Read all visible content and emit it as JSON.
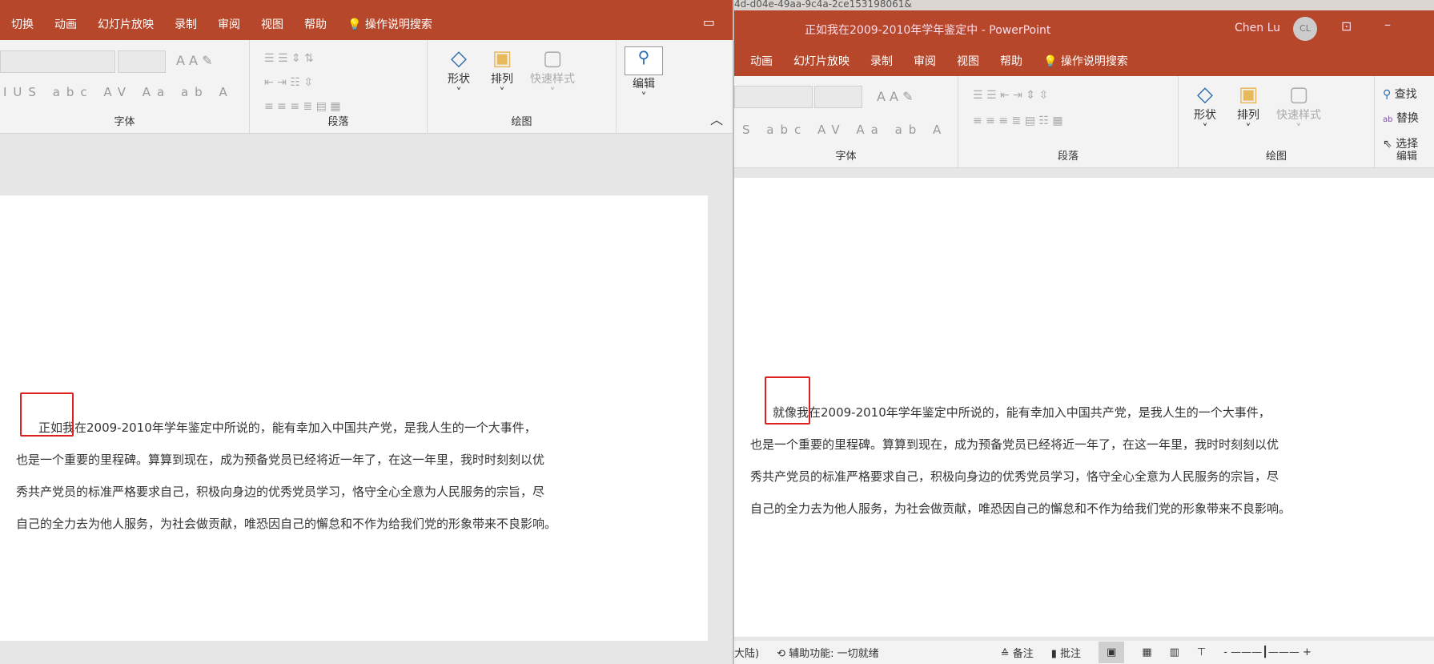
{
  "left_window": {
    "tabs": [
      "切换",
      "动画",
      "幻灯片放映",
      "录制",
      "审阅",
      "视图",
      "帮助"
    ],
    "tell_me": "操作说明搜索",
    "groups": {
      "font": "字体",
      "paragraph": "段落",
      "drawing": "绘图"
    },
    "buttons": {
      "shapes": "形状",
      "arrange": "排列",
      "quick_styles": "快速样式",
      "editing": "编辑"
    },
    "slide_text": {
      "highlight": "正如",
      "lines": [
        "正如我在2009-2010年学年鉴定中所说的，能有幸加入中国共产党，是我人生的一个大事件，",
        "也是一个重要的里程碑。算算到现在，成为预备党员已经将近一年了，在这一年里，我时时刻刻以优",
        "秀共产党员的标准严格要求自己，积极向身边的优秀党员学习，恪守全心全意为人民服务的宗旨，尽",
        "自己的全力去为他人服务，为社会做贡献，唯恐因自己的懈怠和不作为给我们党的形象带来不良影响。"
      ]
    }
  },
  "right_window": {
    "url_fragment": "4d-d04e-49aa-9c4a-2ce153198061&",
    "title": "正如我在2009-2010年学年鉴定中  -  PowerPoint",
    "user": "Chen Lu",
    "avatar": "CL",
    "tabs": [
      "动画",
      "幻灯片放映",
      "录制",
      "审阅",
      "视图",
      "帮助"
    ],
    "tell_me": "操作说明搜索",
    "groups": {
      "font": "字体",
      "paragraph": "段落",
      "drawing": "绘图",
      "editing": "编辑"
    },
    "buttons": {
      "shapes": "形状",
      "arrange": "排列",
      "quick_styles": "快速样式",
      "find": "查找",
      "replace": "替换",
      "select": "选择"
    },
    "slide_text": {
      "highlight": "就像",
      "lines": [
        "就像我在2009-2010年学年鉴定中所说的，能有幸加入中国共产党，是我人生的一个大事件，",
        "也是一个重要的里程碑。算算到现在，成为预备党员已经将近一年了，在这一年里，我时时刻刻以优",
        "秀共产党员的标准严格要求自己，积极向身边的优秀党员学习，恪守全心全意为人民服务的宗旨，尽",
        "自己的全力去为他人服务，为社会做贡献，唯恐因自己的懈怠和不作为给我们党的形象带来不良影响。"
      ]
    },
    "status": {
      "language": "大陆)",
      "accessibility": "辅助功能: 一切就绪",
      "notes": "备注",
      "comments": "批注",
      "zoom_minus": "-",
      "zoom_plus": "+"
    }
  }
}
